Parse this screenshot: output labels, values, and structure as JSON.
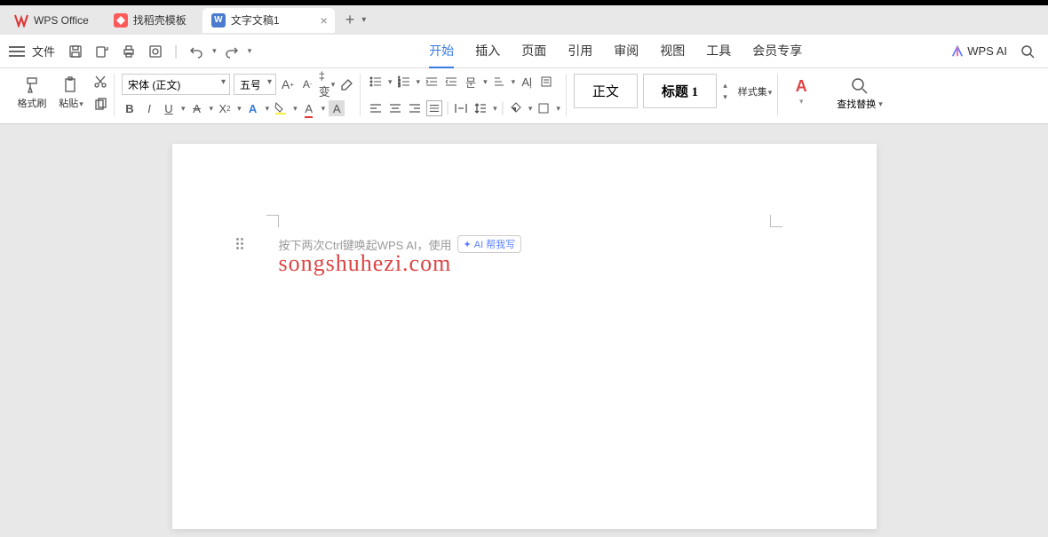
{
  "tabs": {
    "home": "WPS Office",
    "template": "找稻壳模板",
    "doc": "文字文稿1"
  },
  "quickAccess": {
    "file": "文件"
  },
  "menuTabs": {
    "start": "开始",
    "insert": "插入",
    "page": "页面",
    "reference": "引用",
    "review": "审阅",
    "view": "视图",
    "tools": "工具",
    "member": "会员专享"
  },
  "wpsAi": "WPS AI",
  "ribbon": {
    "formatPainter": "格式刷",
    "paste": "粘贴",
    "font": "宋体 (正文)",
    "fontSize": "五号",
    "styleNormal": "正文",
    "styleHeading": "标题 1",
    "styleSet": "样式集",
    "findReplace": "查找替换"
  },
  "document": {
    "placeholder": "按下两次Ctrl键唤起WPS AI，使用",
    "aiChip": "AI 帮我写",
    "watermark": "songshuhezi.com"
  }
}
